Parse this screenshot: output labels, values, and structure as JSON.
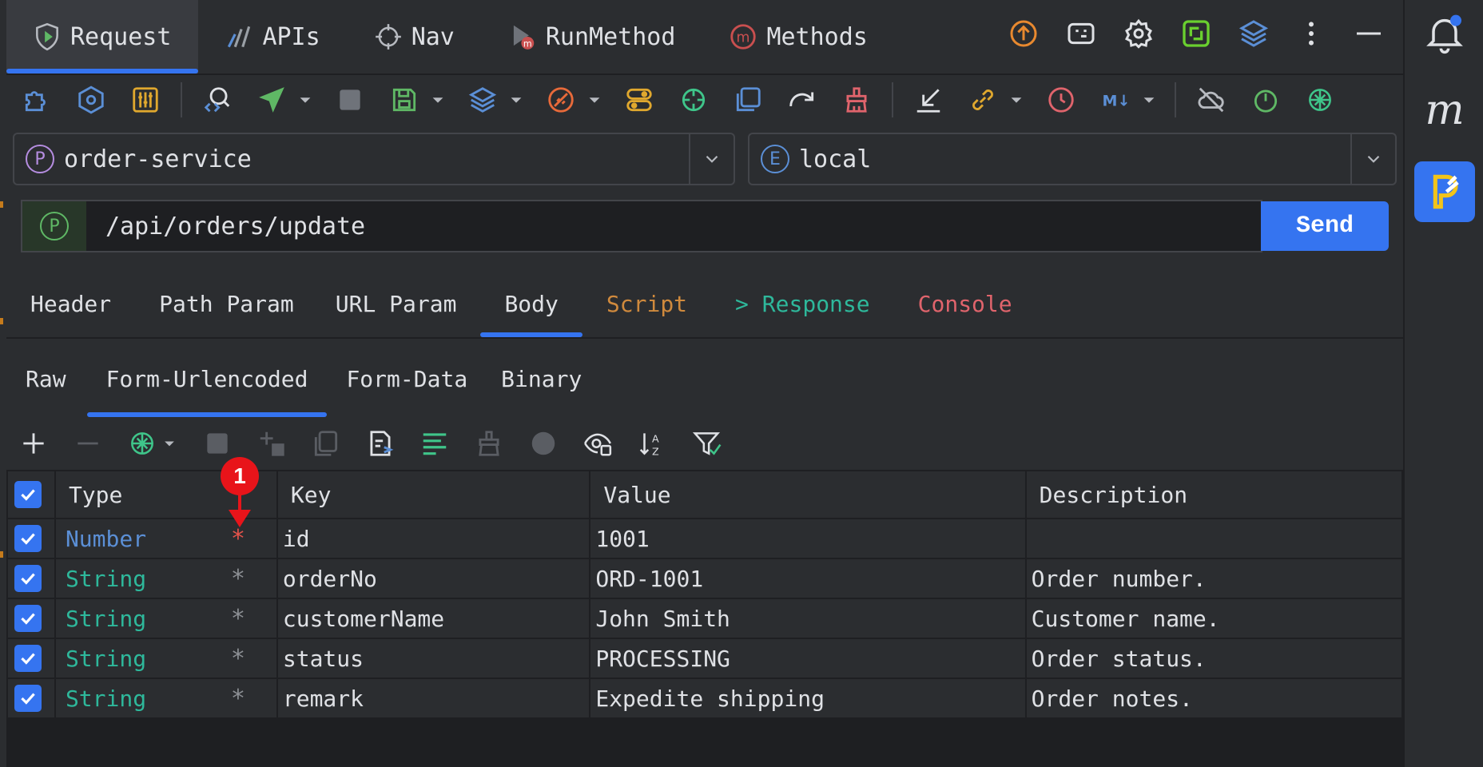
{
  "top_tabs": [
    {
      "label": "Request",
      "icon": "request-shield-icon"
    },
    {
      "label": "APIs",
      "icon": "apis-icon"
    },
    {
      "label": "Nav",
      "icon": "crosshair-icon"
    },
    {
      "label": "RunMethod",
      "icon": "run-method-icon"
    },
    {
      "label": "Methods",
      "icon": "methods-m-icon"
    }
  ],
  "project_select": {
    "badge": "P",
    "value": "order-service"
  },
  "env_select": {
    "badge": "E",
    "value": "local"
  },
  "url": {
    "method_badge": "P",
    "path": "/api/orders/update",
    "send_label": "Send"
  },
  "section_tabs": [
    {
      "label": "Header",
      "color": "#dfe1e5"
    },
    {
      "label": "Path Param",
      "color": "#dfe1e5"
    },
    {
      "label": "URL Param",
      "color": "#dfe1e5"
    },
    {
      "label": "Body",
      "color": "#dfe1e5",
      "active": true
    },
    {
      "label": "Script",
      "color": "#d08a3d"
    },
    {
      "label": "> Response",
      "color": "#2eb89b"
    },
    {
      "label": "Console",
      "color": "#e0646c"
    }
  ],
  "body_tabs": [
    {
      "label": "Raw"
    },
    {
      "label": "Form-Urlencoded",
      "active": true
    },
    {
      "label": "Form-Data"
    },
    {
      "label": "Binary"
    }
  ],
  "table": {
    "headers": {
      "type": "Type",
      "key": "Key",
      "value": "Value",
      "description": "Description"
    },
    "rows": [
      {
        "type": "Number",
        "required": "*",
        "key": "id",
        "value": "1001",
        "description": ""
      },
      {
        "type": "String",
        "required": "*",
        "key": "orderNo",
        "value": "ORD-1001",
        "description": "Order number."
      },
      {
        "type": "String",
        "required": "*",
        "key": "customerName",
        "value": "John Smith",
        "description": "Customer name."
      },
      {
        "type": "String",
        "required": "*",
        "key": "status",
        "value": "PROCESSING",
        "description": "Order status."
      },
      {
        "type": "String",
        "required": "*",
        "key": "remark",
        "value": "Expedite shipping",
        "description": "Order notes."
      }
    ]
  },
  "annotation": {
    "number": "1"
  },
  "sidebar": {
    "m_logo": "m"
  },
  "colors": {
    "accent": "#3574f0",
    "bg": "#2b2d30",
    "panel": "#1e1f22",
    "number_type": "#5b8fd6",
    "string_type": "#2eb89b",
    "required_red": "#e5534b"
  }
}
